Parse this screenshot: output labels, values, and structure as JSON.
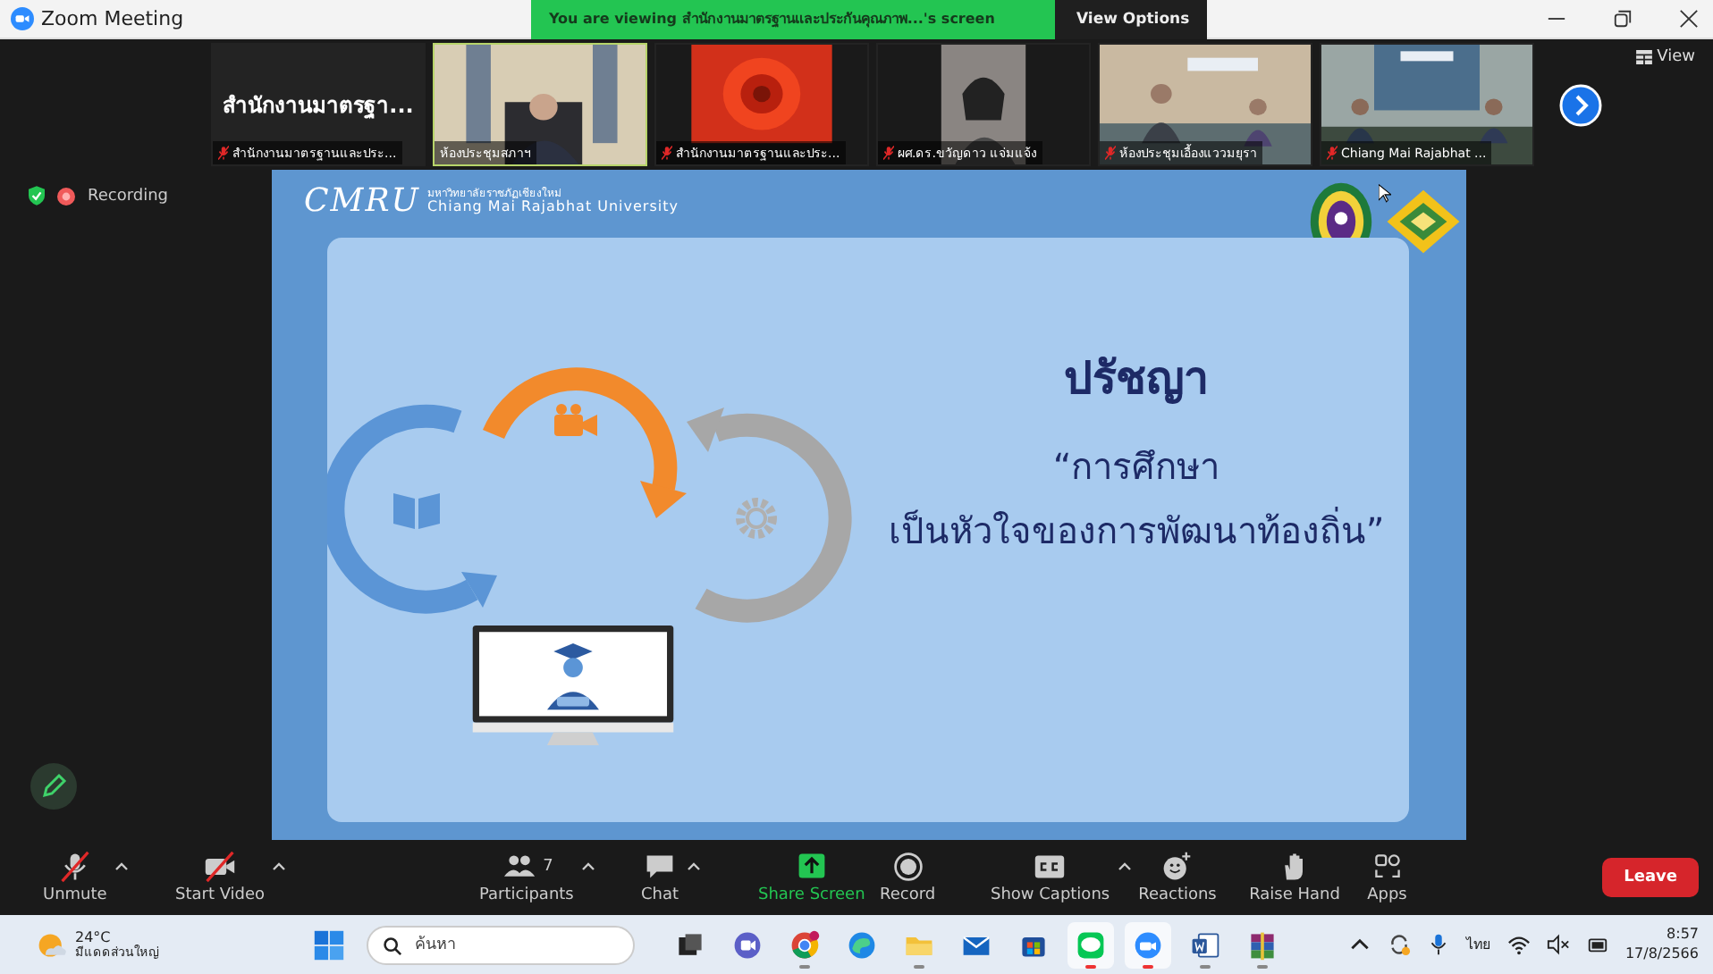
{
  "window": {
    "title": "Zoom Meeting"
  },
  "share_banner": {
    "text": "You are viewing สำนักงานมาตรฐานและประกันคุณภาพ...'s screen",
    "view_options": "View Options"
  },
  "view_button": "View",
  "thumbnails": [
    {
      "kind": "name",
      "display_name": "สำนักงานมาตรฐา...",
      "label": "สำนักงานมาตรฐานและประ...",
      "muted": true,
      "speaking": false
    },
    {
      "kind": "picture",
      "label": "ห้องประชุมสภาฯ",
      "muted": false,
      "speaking": true
    },
    {
      "kind": "picture",
      "label": "สำนักงานมาตรฐานและประ...",
      "muted": true,
      "speaking": false
    },
    {
      "kind": "picture",
      "label": "ผศ.ดร.ขวัญดาว แจ่มแจ้ง",
      "muted": true,
      "speaking": false
    },
    {
      "kind": "picture",
      "label": "ห้องประชุมเอื้องแววมยุรา",
      "muted": true,
      "speaking": false
    },
    {
      "kind": "picture",
      "label": "Chiang Mai Rajabhat ...",
      "muted": true,
      "speaking": false
    }
  ],
  "recording": {
    "label": "Recording"
  },
  "slide": {
    "brand": "CMRU",
    "brand_thai": "มหาวิทยาลัยราชภัฏเชียงใหม่",
    "brand_en": "Chiang Mai Rajabhat University",
    "heading": "ปรัชญา",
    "quote_line_1": "“การศึกษา",
    "quote_line_2": "เป็นหัวใจของการพัฒนาท้องถิ่น”"
  },
  "toolbar": [
    {
      "kind": "mic",
      "label": "Unmute",
      "off": true,
      "caret": true
    },
    {
      "kind": "video",
      "label": "Start Video",
      "off": true,
      "caret": true
    },
    {
      "kind": "participants",
      "label": "Participants",
      "count": "7",
      "off": false,
      "caret": true
    },
    {
      "kind": "chat",
      "label": "Chat",
      "off": false,
      "caret": true
    },
    {
      "kind": "share",
      "label": "Share Screen",
      "off": false,
      "caret": false
    },
    {
      "kind": "record",
      "label": "Record",
      "off": false,
      "caret": false
    },
    {
      "kind": "captions",
      "label": "Show Captions",
      "off": false,
      "caret": true
    },
    {
      "kind": "reactions",
      "label": "Reactions",
      "off": false,
      "caret": false
    },
    {
      "kind": "hand",
      "label": "Raise Hand",
      "off": false,
      "caret": false
    },
    {
      "kind": "apps",
      "label": "Apps",
      "off": false,
      "caret": false
    }
  ],
  "leave": "Leave",
  "taskbar": {
    "temperature": "24°C",
    "weather": "มีแดดส่วนใหญ่",
    "search_placeholder": "ค้นหา",
    "apps": [
      {
        "kind": "taskview",
        "running": false,
        "selected": false
      },
      {
        "kind": "meet",
        "running": false,
        "selected": false
      },
      {
        "kind": "chrome",
        "running": true,
        "selected": false
      },
      {
        "kind": "edge",
        "running": false,
        "selected": false
      },
      {
        "kind": "folder",
        "running": true,
        "selected": false
      },
      {
        "kind": "mail",
        "running": false,
        "selected": false
      },
      {
        "kind": "store",
        "running": false,
        "selected": false
      },
      {
        "kind": "line",
        "running": true,
        "selected": true
      },
      {
        "kind": "zoom",
        "running": true,
        "selected": true
      },
      {
        "kind": "word",
        "running": true,
        "selected": false
      },
      {
        "kind": "winrar",
        "running": true,
        "selected": false
      }
    ],
    "language": "ไทย",
    "time": "8:57",
    "date": "17/8/2566"
  }
}
